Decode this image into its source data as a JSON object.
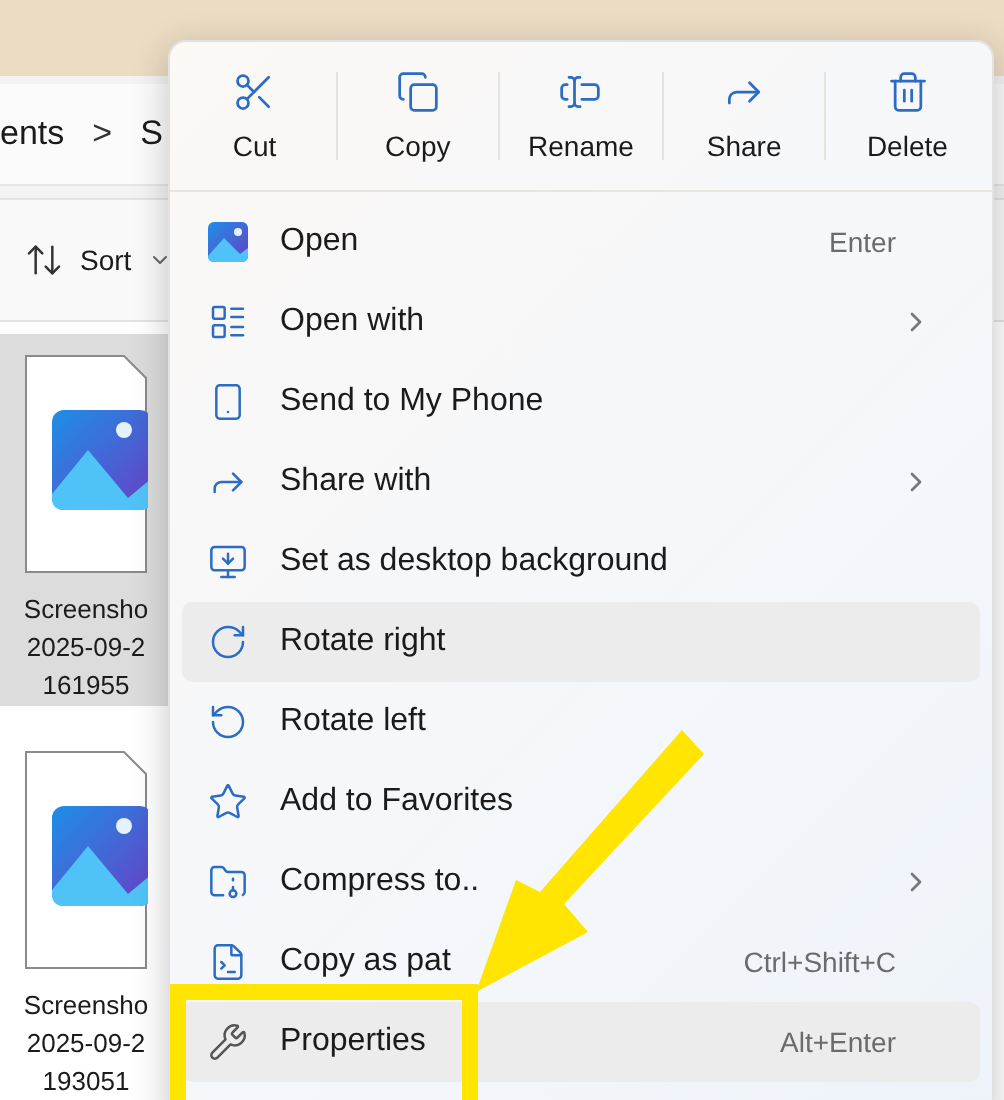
{
  "explorer": {
    "breadcrumb": {
      "path_start": "ents",
      "separator": ">",
      "path_end": "S"
    },
    "toolbar": {
      "sort": "Sort"
    },
    "files": [
      {
        "name_lines": [
          "Screensho",
          "2025-09-2",
          "161955"
        ],
        "selected": true
      },
      {
        "name_lines": [
          "Screensho",
          "2025-09-2",
          "193051"
        ],
        "selected": false
      }
    ]
  },
  "context_menu": {
    "actions": [
      {
        "kind": "cut",
        "label": "Cut"
      },
      {
        "kind": "copy",
        "label": "Copy"
      },
      {
        "kind": "rename",
        "label": "Rename"
      },
      {
        "kind": "share",
        "label": "Share"
      },
      {
        "kind": "delete",
        "label": "Delete"
      }
    ],
    "items": [
      {
        "kind": "open",
        "label": "Open",
        "shortcut": "Enter",
        "submenu": false,
        "highlighted": false
      },
      {
        "kind": "openwith",
        "label": "Open with",
        "submenu": true,
        "highlighted": false
      },
      {
        "kind": "phone",
        "label": "Send to My Phone",
        "submenu": false,
        "highlighted": false
      },
      {
        "kind": "share",
        "label": "Share with",
        "submenu": true,
        "highlighted": false
      },
      {
        "kind": "background",
        "label": "Set as desktop background",
        "submenu": false,
        "highlighted": false
      },
      {
        "kind": "rotateright",
        "label": "Rotate right",
        "submenu": false,
        "highlighted": true
      },
      {
        "kind": "rotateleft",
        "label": "Rotate left",
        "submenu": false,
        "highlighted": false
      },
      {
        "kind": "favorite",
        "label": "Add to Favorites",
        "submenu": false,
        "highlighted": false
      },
      {
        "kind": "compress",
        "label": "Compress to..",
        "submenu": true,
        "highlighted": false
      },
      {
        "kind": "copypath",
        "label": "Copy as pat",
        "shortcut": "Ctrl+Shift+C",
        "submenu": false,
        "highlighted": false
      },
      {
        "kind": "properties",
        "label": "Properties",
        "shortcut": "Alt+Enter",
        "submenu": false,
        "highlighted": true,
        "boxed": true
      }
    ]
  },
  "annotation": {
    "arrow": true
  }
}
